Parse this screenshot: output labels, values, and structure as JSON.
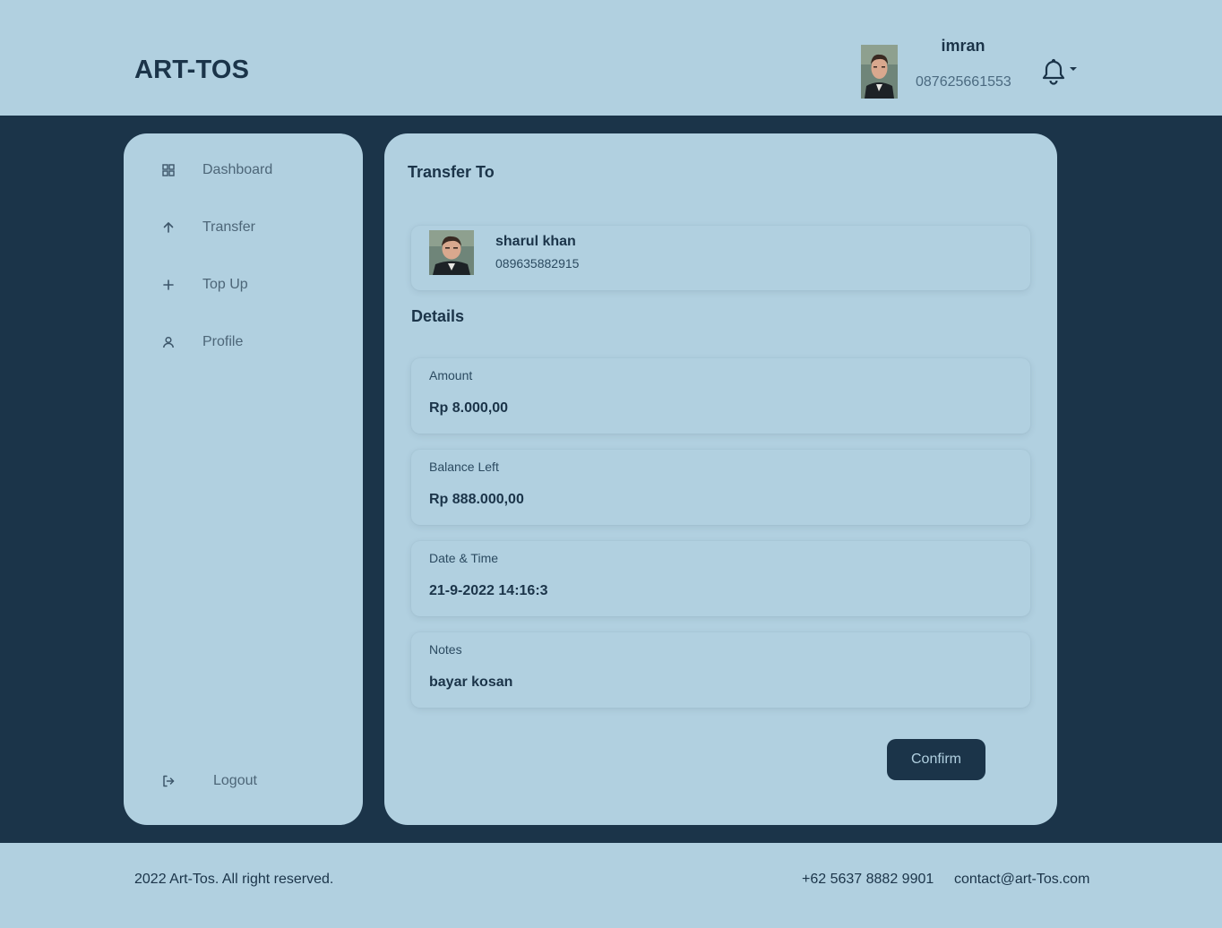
{
  "header": {
    "brand": "ART-TOS",
    "user": {
      "name": "imran",
      "phone": "087625661553"
    },
    "icons": {
      "avatar": "user-photo",
      "notification": "bell-icon",
      "dropdown": "caret-down-icon"
    }
  },
  "sidebar": {
    "items": [
      {
        "label": "Dashboard",
        "icon": "grid-icon"
      },
      {
        "label": "Transfer",
        "icon": "arrow-up-icon"
      },
      {
        "label": "Top Up",
        "icon": "plus-icon"
      },
      {
        "label": "Profile",
        "icon": "user-icon"
      }
    ],
    "logout": {
      "label": "Logout",
      "icon": "logout-icon"
    }
  },
  "main": {
    "transfer_title": "Transfer To",
    "recipient": {
      "name": "sharul khan",
      "phone": "089635882915"
    },
    "details_title": "Details",
    "details": [
      {
        "label": "Amount",
        "value": "Rp 8.000,00"
      },
      {
        "label": "Balance Left",
        "value": "Rp 888.000,00"
      },
      {
        "label": "Date & Time",
        "value": "21-9-2022 14:16:3"
      },
      {
        "label": "Notes",
        "value": "bayar kosan"
      }
    ],
    "confirm_label": "Confirm"
  },
  "footer": {
    "copyright": "2022 Art-Tos. All right reserved.",
    "phone": "+62 5637 8882 9901",
    "email": "contact@art-Tos.com"
  },
  "colors": {
    "primary": "#1b3449",
    "surface": "#b1d0e0",
    "muted": "#4d6678"
  }
}
